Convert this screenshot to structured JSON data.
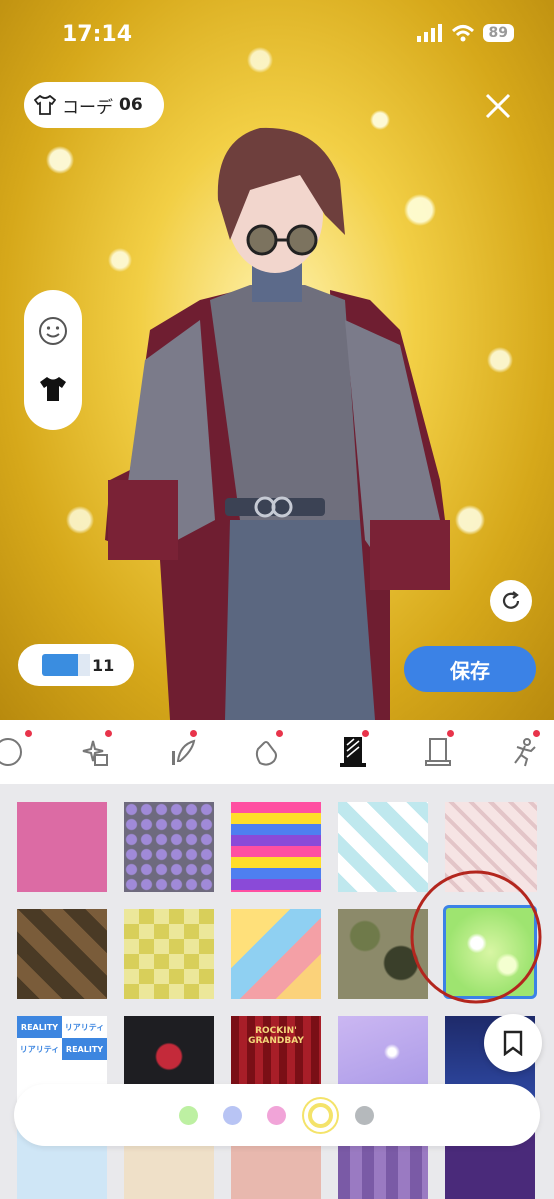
{
  "status": {
    "time": "17:14",
    "battery": "89"
  },
  "outfit": {
    "prefix": "コーデ",
    "number": "06"
  },
  "ticket": {
    "count": "11"
  },
  "save_label": "保存",
  "tabs": [
    {
      "icon": "face-icon",
      "badge": true
    },
    {
      "icon": "sparkle-effect-icon",
      "badge": true
    },
    {
      "icon": "wing-icon",
      "badge": true
    },
    {
      "icon": "hand-wave-icon",
      "badge": true
    },
    {
      "icon": "background-pattern-icon",
      "badge": true,
      "selected": true
    },
    {
      "icon": "stand-frame-icon",
      "badge": true
    },
    {
      "icon": "pose-icon",
      "badge": true
    }
  ],
  "patterns": [
    "pink-solid",
    "purple-polka-dots",
    "rainbow-zigzag",
    "mint-diagonal-stripes",
    "pink-plaid",
    "brown-argyle",
    "yellow-checker",
    "pastel-triangles",
    "green-camo",
    "green-bokeh",
    "reality-logo-pattern",
    "red-flower-dark",
    "red-theater-curtain",
    "lavender-starry",
    "night-city",
    "light-blue-cloud",
    "japanese-fan",
    "pink-bear-pattern",
    "purple-cat-pattern",
    "purple-castle"
  ],
  "selected_pattern": "green-bokeh",
  "tile_texts": {
    "reality_en": "REALITY",
    "reality_jp": "リアリティ",
    "theater_title": "ROCKIN'",
    "theater_sub": "GRANDBAY"
  },
  "palette_colors": [
    "#bdf0a2",
    "#b8c4f4",
    "#f1a4d8",
    "#f4e36a",
    "#b5b9bc"
  ],
  "palette_selected_index": 3,
  "colors": {
    "accent": "#3b82e6",
    "badge": "#e8344b",
    "annotation_circle": "#b3261e"
  }
}
